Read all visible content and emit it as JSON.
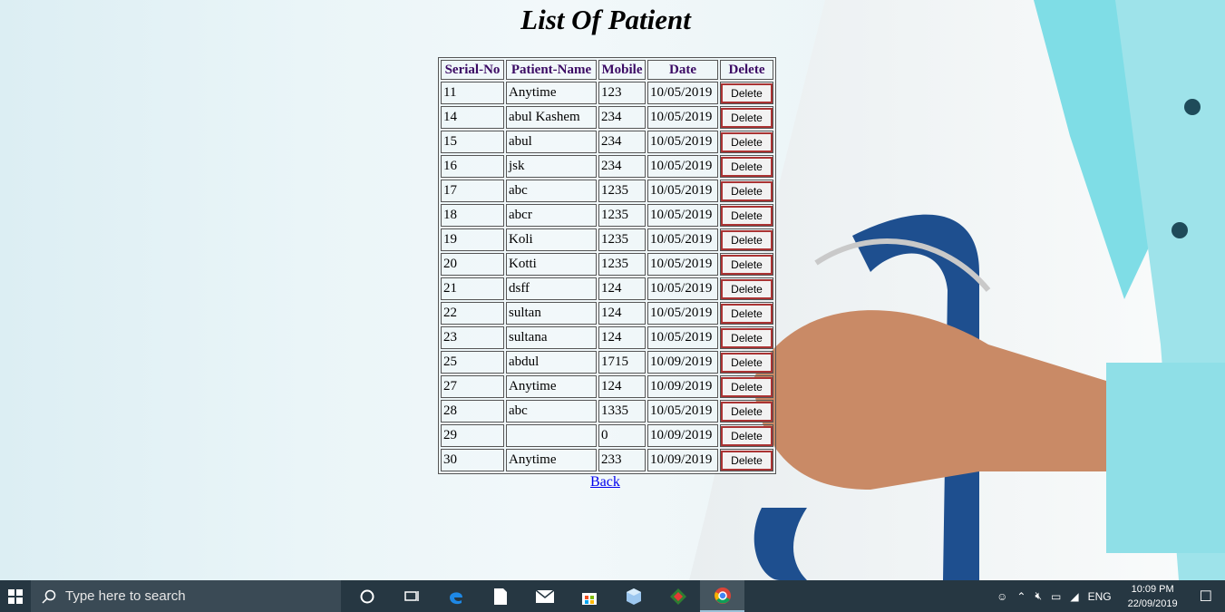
{
  "page": {
    "title": "List Of Patient",
    "back_link": "Back"
  },
  "table": {
    "headers": [
      "Serial-No",
      "Patient-Name",
      "Mobile",
      "Date",
      "Delete"
    ],
    "delete_label": "Delete",
    "rows": [
      {
        "serial": "11",
        "name": "Anytime",
        "mobile": "123",
        "date": "10/05/2019"
      },
      {
        "serial": "14",
        "name": "abul Kashem",
        "mobile": "234",
        "date": "10/05/2019"
      },
      {
        "serial": "15",
        "name": "abul",
        "mobile": "234",
        "date": "10/05/2019"
      },
      {
        "serial": "16",
        "name": "jsk",
        "mobile": "234",
        "date": "10/05/2019"
      },
      {
        "serial": "17",
        "name": "abc",
        "mobile": "1235",
        "date": "10/05/2019"
      },
      {
        "serial": "18",
        "name": "abcr",
        "mobile": "1235",
        "date": "10/05/2019"
      },
      {
        "serial": "19",
        "name": "Koli",
        "mobile": "1235",
        "date": "10/05/2019"
      },
      {
        "serial": "20",
        "name": "Kotti",
        "mobile": "1235",
        "date": "10/05/2019"
      },
      {
        "serial": "21",
        "name": "dsff",
        "mobile": "124",
        "date": "10/05/2019"
      },
      {
        "serial": "22",
        "name": "sultan",
        "mobile": "124",
        "date": "10/05/2019"
      },
      {
        "serial": "23",
        "name": "sultana",
        "mobile": "124",
        "date": "10/05/2019"
      },
      {
        "serial": "25",
        "name": "abdul",
        "mobile": "1715",
        "date": "10/09/2019"
      },
      {
        "serial": "27",
        "name": "Anytime",
        "mobile": "124",
        "date": "10/09/2019"
      },
      {
        "serial": "28",
        "name": "abc",
        "mobile": "1335",
        "date": "10/05/2019"
      },
      {
        "serial": "29",
        "name": "",
        "mobile": "0",
        "date": "10/09/2019"
      },
      {
        "serial": "30",
        "name": "Anytime",
        "mobile": "233",
        "date": "10/09/2019"
      }
    ]
  },
  "taskbar": {
    "search_placeholder": "Type here to search",
    "icons": [
      "cortana-icon",
      "task-view-icon",
      "edge-icon",
      "file-icon",
      "mail-icon",
      "store-icon",
      "3d-box-icon",
      "app-icon",
      "chrome-icon"
    ],
    "tray": {
      "language": "ENG",
      "time": "10:09 PM",
      "date": "22/09/2019"
    }
  },
  "colors": {
    "header_text": "#3b0a64",
    "delete_border": "#aa3333",
    "taskbar": "#263742",
    "link": "#0000ee"
  }
}
